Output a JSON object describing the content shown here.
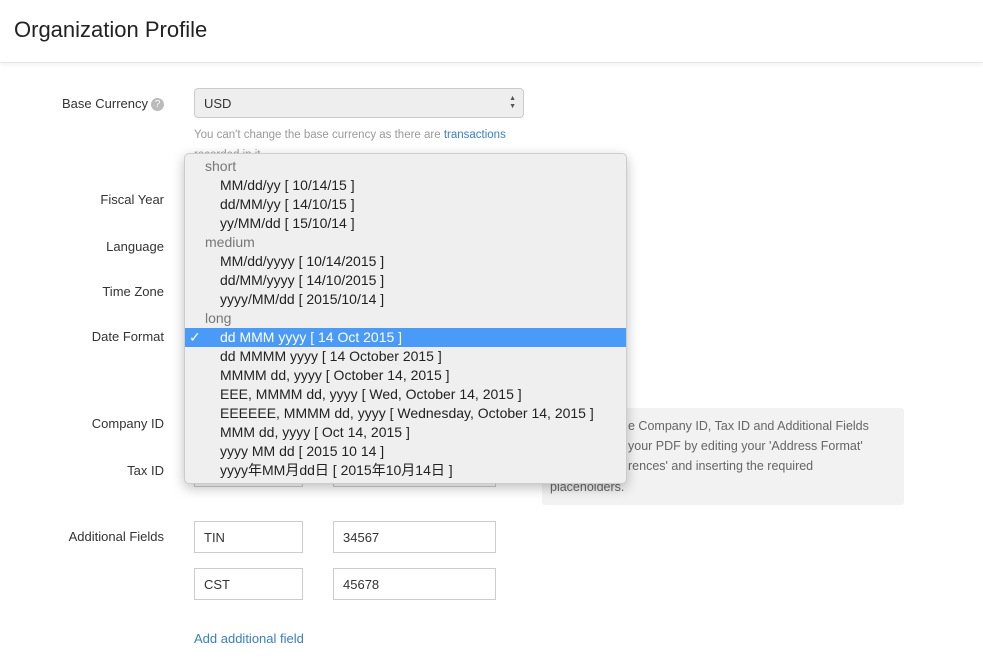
{
  "header": {
    "title": "Organization Profile"
  },
  "form": {
    "base_currency": {
      "label": "Base Currency",
      "help_icon": "question-circle-icon",
      "value": "USD",
      "hint": "You can't change the base currency as there are ",
      "hint_link": "transactions",
      "hint_tail": " recorded in it."
    },
    "fiscal_year_label": "Fiscal Year",
    "language_label": "Language",
    "time_zone_label": "Time Zone",
    "date_format_label": "Date Format",
    "company_id_label": "Company ID",
    "tax_id_label": "Tax ID",
    "additional_fields_label": "Additional Fields",
    "additional_fields": [
      {
        "name": "TIN",
        "value": "34567"
      },
      {
        "name": "CST",
        "value": "45678"
      }
    ],
    "add_field_link": "Add additional field"
  },
  "info_box": {
    "lines": [
      "e Company ID, Tax ID and Additional Fields",
      "your PDF by editing your 'Address Format'",
      "rences' and inserting the required",
      "placeholders."
    ]
  },
  "date_format_dropdown": {
    "check_mark": "✓",
    "groups": [
      {
        "label": "short",
        "options": [
          "MM/dd/yy [ 10/14/15 ]",
          "dd/MM/yy [ 14/10/15 ]",
          "yy/MM/dd [ 15/10/14 ]"
        ]
      },
      {
        "label": "medium",
        "options": [
          "MM/dd/yyyy [ 10/14/2015 ]",
          "dd/MM/yyyy [ 14/10/2015 ]",
          "yyyy/MM/dd [ 2015/10/14 ]"
        ]
      },
      {
        "label": "long",
        "options": [
          "dd MMM yyyy [ 14 Oct 2015 ]",
          "dd MMMM yyyy [ 14 October 2015 ]",
          "MMMM dd, yyyy [ October 14, 2015 ]",
          "EEE, MMMM dd, yyyy [ Wed, October 14, 2015 ]",
          "EEEEEE, MMMM dd, yyyy [ Wednesday, October 14, 2015 ]",
          "MMM dd, yyyy [ Oct 14, 2015 ]",
          "yyyy MM dd [ 2015 10 14 ]",
          "yyyy年MM月dd日 [ 2015年10月14日 ]"
        ]
      }
    ],
    "selected": "dd MMM yyyy [ 14 Oct 2015 ]",
    "colors": {
      "selected_bg": "#4a9af7",
      "link": "#3a7fc1"
    }
  }
}
